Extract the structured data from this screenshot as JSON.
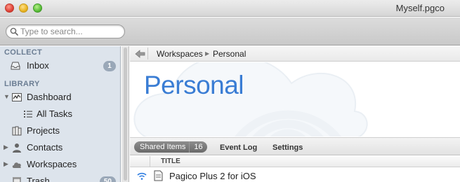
{
  "window": {
    "title": "Myself.pgco"
  },
  "search": {
    "placeholder": "Type to search..."
  },
  "sidebar": {
    "sections": [
      {
        "title": "COLLECT"
      },
      {
        "title": "LIBRARY"
      }
    ],
    "items": [
      {
        "label": "Inbox",
        "icon": "inbox-icon",
        "badge": "1"
      },
      {
        "label": "Dashboard",
        "icon": "dashboard-icon"
      },
      {
        "label": "All Tasks",
        "icon": "list-icon"
      },
      {
        "label": "Projects",
        "icon": "projects-icon"
      },
      {
        "label": "Contacts",
        "icon": "contacts-icon"
      },
      {
        "label": "Workspaces",
        "icon": "cloud-icon"
      },
      {
        "label": "Trash",
        "icon": "trash-icon",
        "badge": "50"
      }
    ]
  },
  "breadcrumb": {
    "items": [
      "Workspaces",
      "Personal"
    ]
  },
  "hero": {
    "title": "Personal"
  },
  "tabs": {
    "active": {
      "label": "Shared Items",
      "count": "16"
    },
    "others": [
      "Event Log",
      "Settings"
    ]
  },
  "table": {
    "columns": [
      "TITLE"
    ],
    "rows": [
      {
        "title": "Pagico Plus 2 for iOS"
      }
    ]
  },
  "colors": {
    "accent": "#3a7dd4",
    "sidebar_bg": "#dde4ec",
    "badge": "#9aa8b8"
  }
}
